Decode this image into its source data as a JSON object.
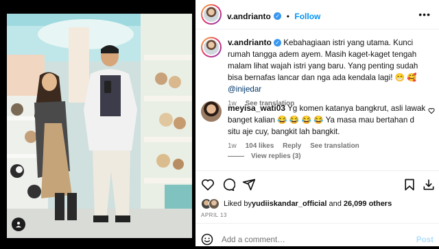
{
  "post": {
    "username": "v.andrianto",
    "follow_label": "Follow",
    "more_icon": "more-dots-icon"
  },
  "caption": {
    "username": "v.andrianto",
    "text": "Kebahagiaan istri yang utama. Kunci rumah tangga adem ayem. Masih kaget-kaget tengah malam lihat wajah istri yang baru. Yang penting sudah bisa bernafas lancar dan nga ada kendala lagi! 😁 🥰 ",
    "mention": "@inijedar",
    "time": "1w",
    "see_translation": "See translation"
  },
  "comment": {
    "username": "meyisa_wati03",
    "text": "Yg komen katanya bangkrut, asli lawak banget kalian 😂 😂 😂 😂 Ya masa mau bertahan d situ aje cuy, bangkit lah bangkit.",
    "time": "1w",
    "likes": "104 likes",
    "reply": "Reply",
    "see_translation": "See translation",
    "view_replies": "View replies (3)"
  },
  "likes": {
    "prefix": "Liked by ",
    "user": "yudiiskandar_official",
    "middle": " and ",
    "count": "26,099 others"
  },
  "date": "APRIL 13",
  "add_comment": {
    "placeholder": "Add a comment…",
    "post_label": "Post"
  },
  "colors": {
    "link_blue": "#0095f6",
    "mention": "#00376b",
    "secondary": "#737373"
  }
}
